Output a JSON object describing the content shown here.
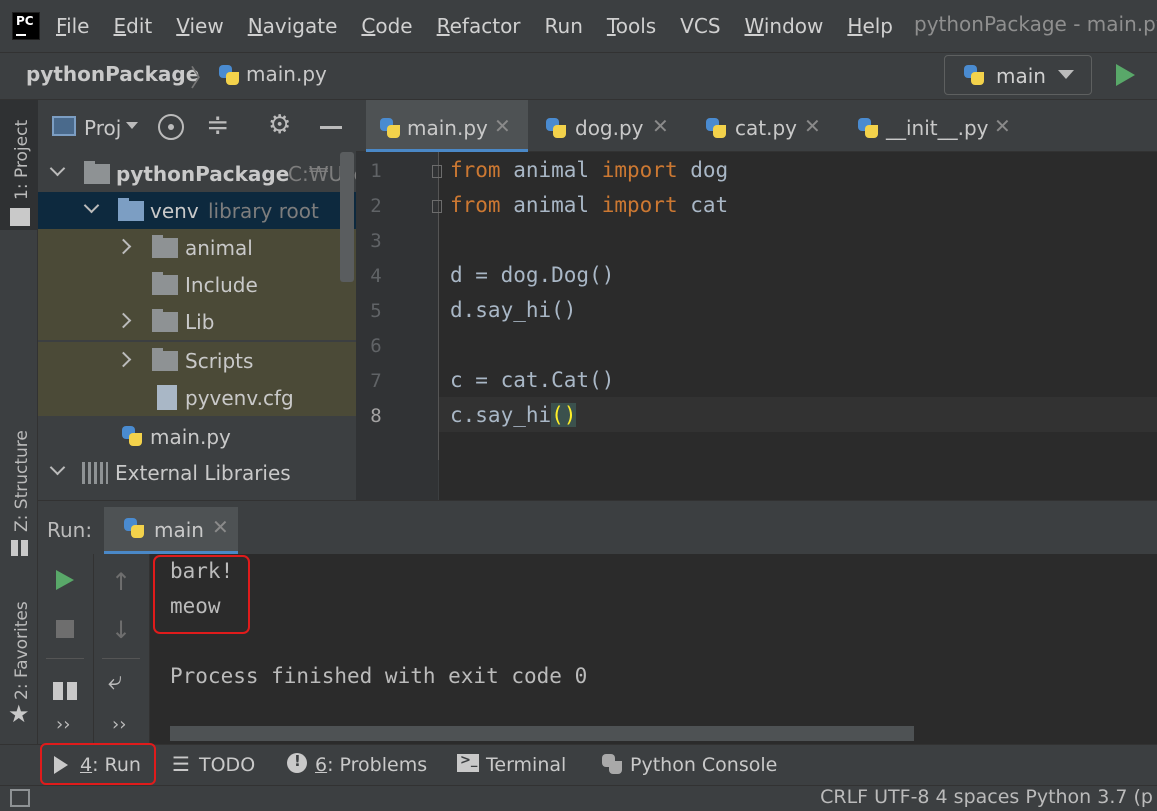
{
  "menubar": {
    "logo_text": "PC",
    "items": [
      {
        "label": "File",
        "u": "F",
        "rest": "ile"
      },
      {
        "label": "Edit",
        "u": "E",
        "rest": "dit"
      },
      {
        "label": "View",
        "u": "V",
        "rest": "iew"
      },
      {
        "label": "Navigate",
        "u": "N",
        "rest": "avigate"
      },
      {
        "label": "Code",
        "u": "C",
        "rest": "ode"
      },
      {
        "label": "Refactor",
        "u": "R",
        "rest": "efactor"
      },
      {
        "label": "Run",
        "u": "",
        "rest": "Run"
      },
      {
        "label": "Tools",
        "u": "T",
        "rest": "ools"
      },
      {
        "label": "VCS",
        "u": "",
        "rest": "VCS"
      },
      {
        "label": "Window",
        "u": "W",
        "rest": "indow"
      },
      {
        "label": "Help",
        "u": "H",
        "rest": "elp"
      }
    ],
    "window_title": "pythonPackage - main.py"
  },
  "navbar": {
    "project": "pythonPackage",
    "separator": "〉",
    "file": "main.py",
    "run_config": "main"
  },
  "left_stripe": {
    "project": "1: Project",
    "structure": "Z: Structure",
    "favorites": "2: Favorites"
  },
  "project_panel": {
    "title": "Proj",
    "tree": [
      {
        "label": "pythonPackage",
        "extra": "C:₩Use"
      },
      {
        "label": "venv",
        "extra": "library root"
      },
      {
        "label": "animal"
      },
      {
        "label": "Include"
      },
      {
        "label": "Lib"
      },
      {
        "label": "Scripts"
      },
      {
        "label": "pyvenv.cfg"
      },
      {
        "label": "main.py"
      },
      {
        "label": "External Libraries"
      }
    ]
  },
  "editor": {
    "tabs": [
      "main.py",
      "dog.py",
      "cat.py",
      "__init__.py"
    ],
    "close": "✕",
    "line_numbers": [
      "1",
      "2",
      "3",
      "4",
      "5",
      "6",
      "7",
      "8"
    ],
    "lines": {
      "l1_kw1": "from",
      "l1_mod": " animal ",
      "l1_kw2": "import",
      "l1_name": " dog",
      "l2_kw1": "from",
      "l2_mod": " animal ",
      "l2_kw2": "import",
      "l2_name": " cat",
      "l4": "d = dog.Dog()",
      "l5": "d.say_hi()",
      "l7": "c = cat.Cat()",
      "l8_pre": "c.say_hi",
      "l8_paren": "()"
    }
  },
  "run_panel": {
    "label": "Run:",
    "tab": "main",
    "output": [
      "bark!",
      "meow",
      "Process finished with exit code 0"
    ]
  },
  "bottom_bar": {
    "run": {
      "u": "4",
      "rest": ": Run"
    },
    "todo": "TODO",
    "problems": {
      "u": "6",
      "rest": ": Problems"
    },
    "terminal": "Terminal",
    "python_console": "Python Console"
  },
  "status_bar": {
    "text": "CRLF  UTF-8  4 spaces  Python 3.7 (p"
  },
  "colors": {
    "keyword": "#cc7832",
    "code_text": "#a9b7c6",
    "run_green": "#59a869",
    "highlight_red": "#e01b1b",
    "selection": "#0d293e"
  }
}
